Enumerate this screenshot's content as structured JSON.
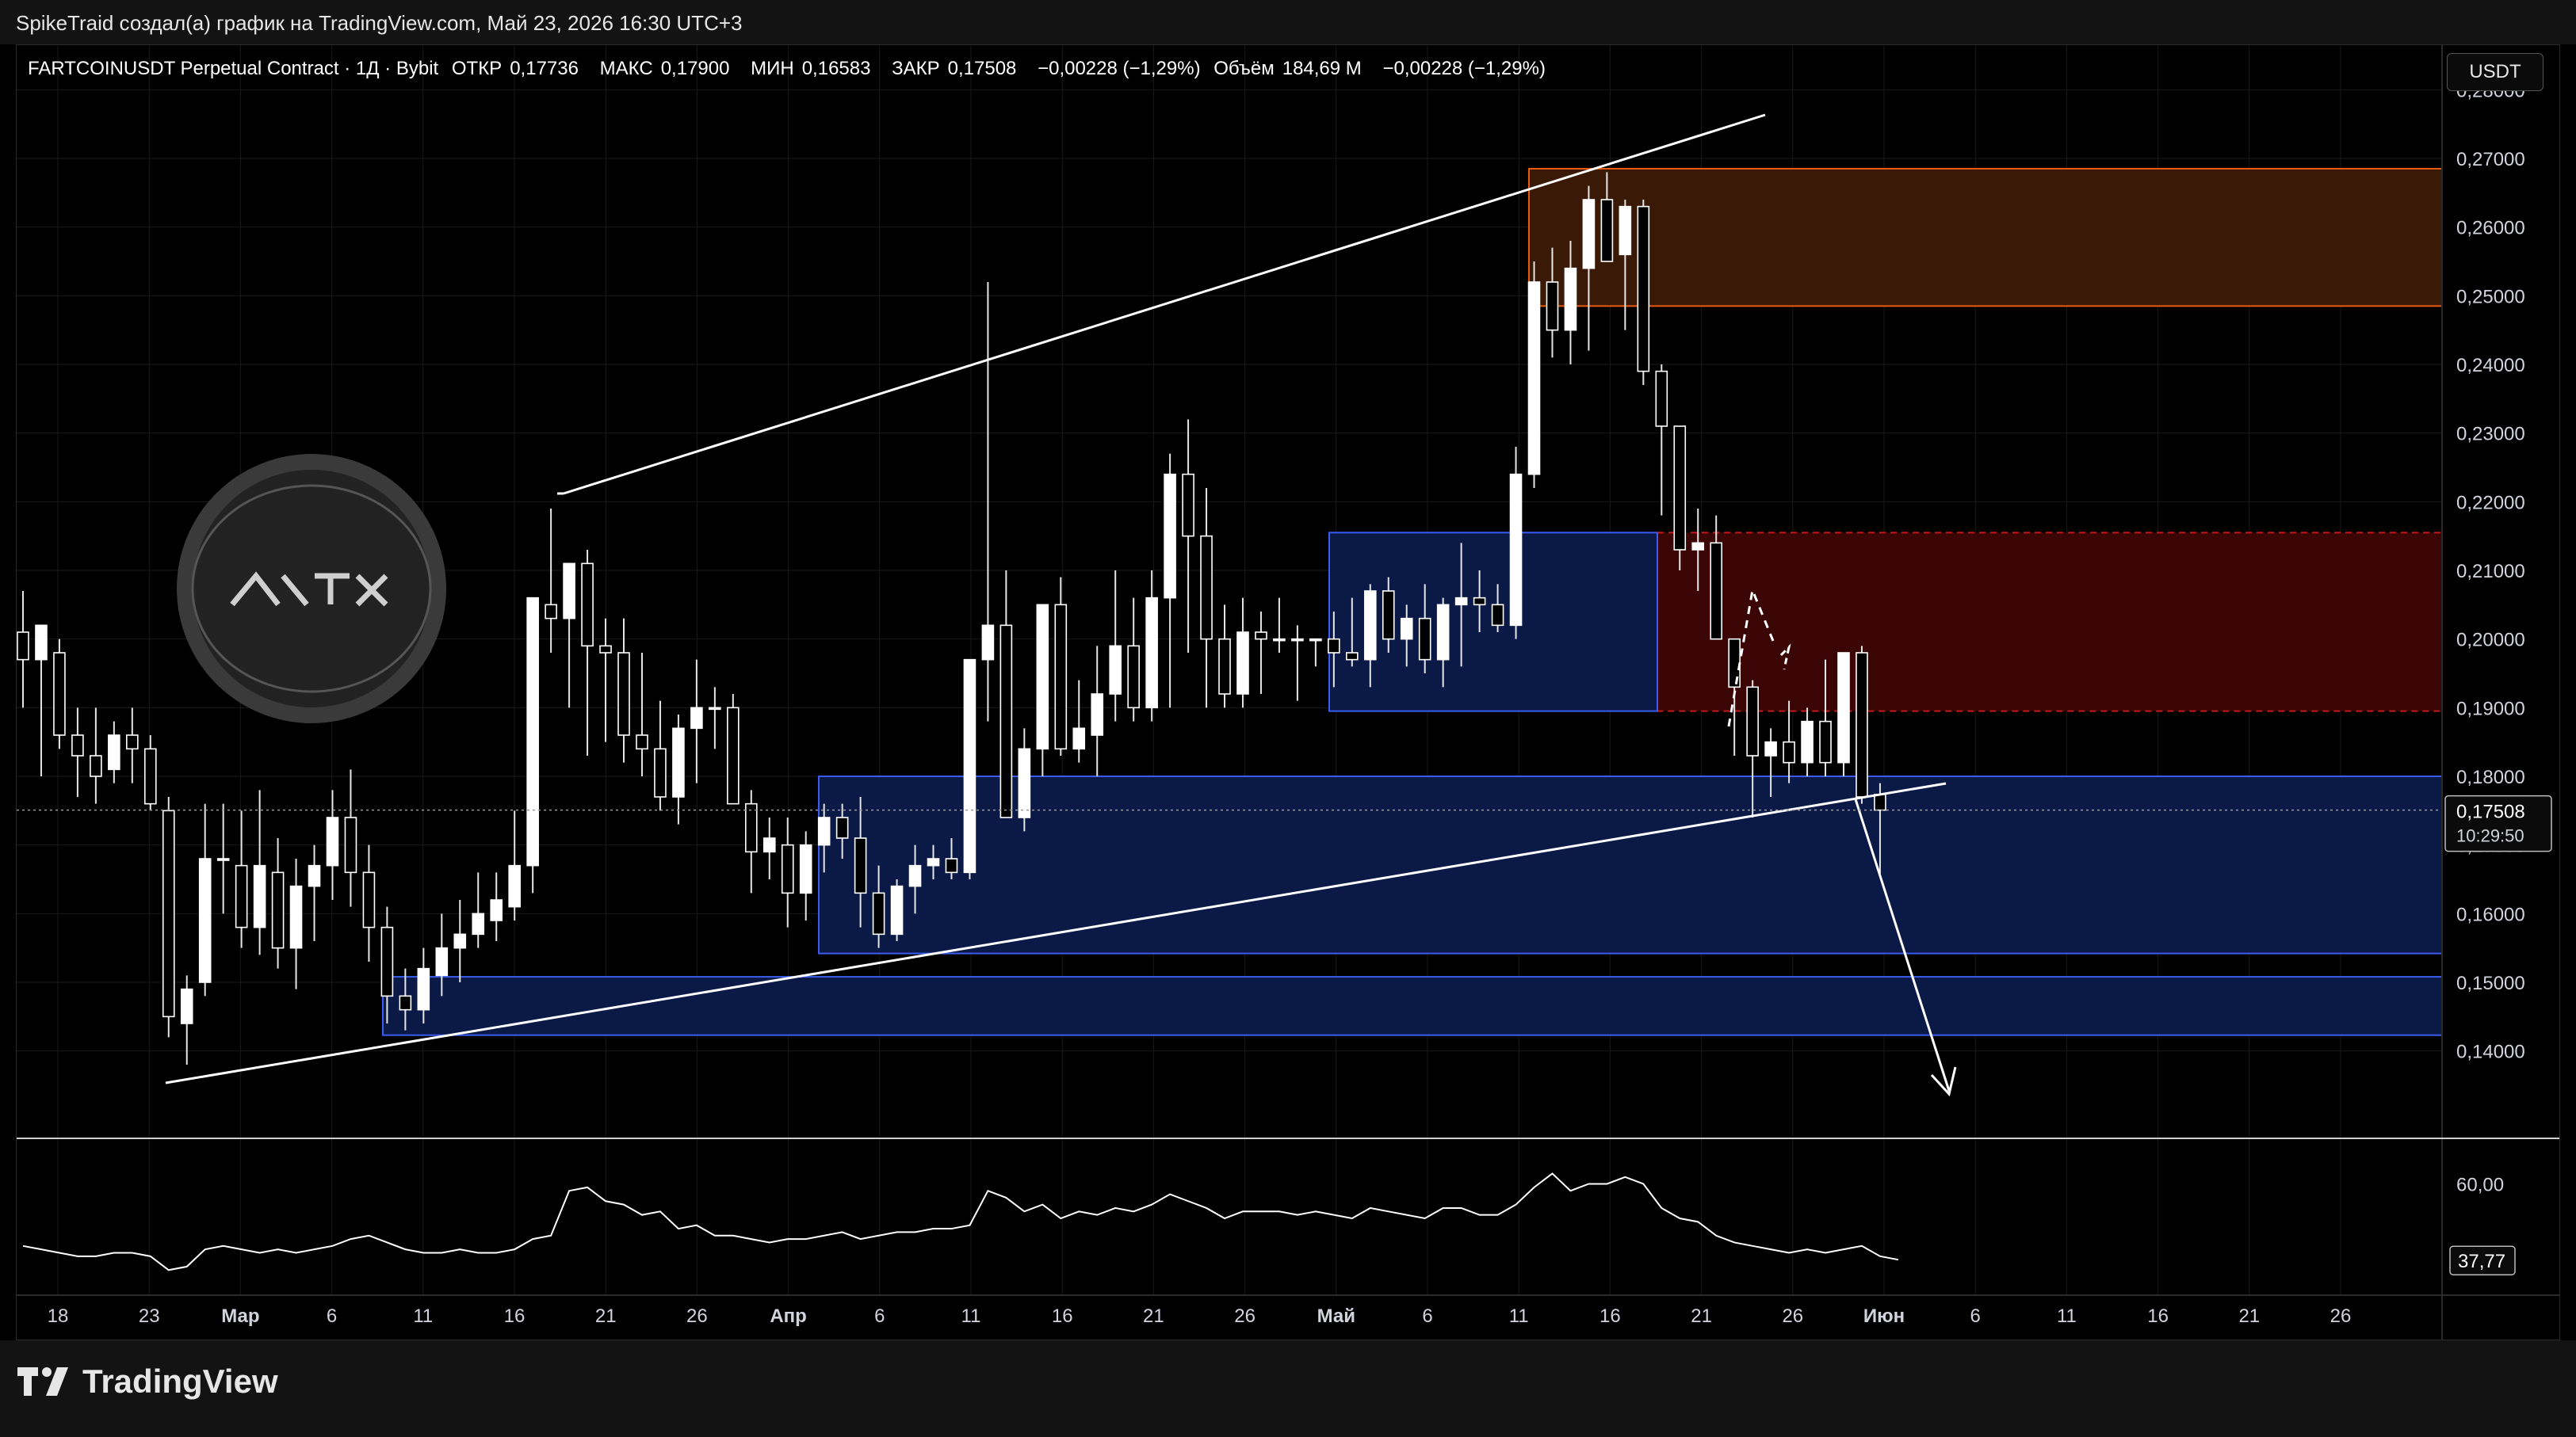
{
  "header": {
    "credit": "SpikeTraid создал(а) график на TradingView.com, Май 23, 2026 16:30 UTC+3"
  },
  "legend": {
    "symbol": "FARTCOINUSDT Perpetual Contract · 1Д · Bybit",
    "open_label": "ОТКР",
    "open": "0,17736",
    "high_label": "МАКС",
    "high": "0,17900",
    "low_label": "МИН",
    "low": "0,16583",
    "close_label": "ЗАКР",
    "close": "0,17508",
    "change": "−0,00228 (−1,29%)",
    "volume_label": "Объём",
    "volume": "184,69 M",
    "volume_change": "−0,00228 (−1,29%)"
  },
  "currency_button": "USDT",
  "footer": {
    "brand": "TradingView"
  },
  "colors": {
    "background": "#000000",
    "candle_up": "#ffffff",
    "candle_down": "#ffffff",
    "resistance_zone": "#e8590c",
    "red_zone": "#c41a1a",
    "blue_zone": "#1a3bd6",
    "trendline": "#ffffff",
    "indicator_line": "#ffffff"
  },
  "chart_data": {
    "type": "candlestick",
    "price_axis": {
      "currency": "USDT",
      "ticks": [
        "0,28000",
        "0,27000",
        "0,26000",
        "0,25000",
        "0,24000",
        "0,23000",
        "0,22000",
        "0,21000",
        "0,20000",
        "0,19000",
        "0,18000",
        "0,17000",
        "0,16000",
        "0,15000",
        "0,14000"
      ],
      "range": [
        0.1335,
        0.2835
      ],
      "last_price_label": "0,17508",
      "last_price": 0.17508,
      "countdown": "10:29:50"
    },
    "time_axis": {
      "ticks": [
        "18",
        "23",
        "Мар",
        "6",
        "11",
        "16",
        "21",
        "26",
        "Апр",
        "6",
        "11",
        "16",
        "21",
        "26",
        "Май",
        "6",
        "11",
        "16",
        "21",
        "26",
        "Июн",
        "6",
        "11",
        "16",
        "21",
        "26"
      ],
      "bold_ticks": [
        "Мар",
        "Апр",
        "Май",
        "Июн"
      ]
    },
    "candles": [
      {
        "o": 0.201,
        "h": 0.207,
        "l": 0.19,
        "c": 0.197
      },
      {
        "o": 0.197,
        "h": 0.201,
        "l": 0.18,
        "c": 0.202
      },
      {
        "o": 0.198,
        "h": 0.2,
        "l": 0.184,
        "c": 0.186
      },
      {
        "o": 0.186,
        "h": 0.19,
        "l": 0.177,
        "c": 0.183
      },
      {
        "o": 0.183,
        "h": 0.19,
        "l": 0.176,
        "c": 0.18
      },
      {
        "o": 0.181,
        "h": 0.188,
        "l": 0.179,
        "c": 0.186
      },
      {
        "o": 0.186,
        "h": 0.19,
        "l": 0.179,
        "c": 0.184
      },
      {
        "o": 0.184,
        "h": 0.186,
        "l": 0.175,
        "c": 0.176
      },
      {
        "o": 0.175,
        "h": 0.177,
        "l": 0.142,
        "c": 0.145
      },
      {
        "o": 0.144,
        "h": 0.151,
        "l": 0.138,
        "c": 0.149
      },
      {
        "o": 0.15,
        "h": 0.176,
        "l": 0.148,
        "c": 0.168
      },
      {
        "o": 0.168,
        "h": 0.176,
        "l": 0.16,
        "c": 0.168
      },
      {
        "o": 0.167,
        "h": 0.175,
        "l": 0.155,
        "c": 0.158
      },
      {
        "o": 0.158,
        "h": 0.178,
        "l": 0.154,
        "c": 0.167
      },
      {
        "o": 0.166,
        "h": 0.171,
        "l": 0.152,
        "c": 0.155
      },
      {
        "o": 0.155,
        "h": 0.168,
        "l": 0.149,
        "c": 0.164
      },
      {
        "o": 0.164,
        "h": 0.17,
        "l": 0.156,
        "c": 0.167
      },
      {
        "o": 0.167,
        "h": 0.178,
        "l": 0.162,
        "c": 0.174
      },
      {
        "o": 0.174,
        "h": 0.181,
        "l": 0.161,
        "c": 0.166
      },
      {
        "o": 0.166,
        "h": 0.17,
        "l": 0.153,
        "c": 0.158
      },
      {
        "o": 0.158,
        "h": 0.161,
        "l": 0.144,
        "c": 0.148
      },
      {
        "o": 0.148,
        "h": 0.152,
        "l": 0.143,
        "c": 0.146
      },
      {
        "o": 0.146,
        "h": 0.155,
        "l": 0.144,
        "c": 0.152
      },
      {
        "o": 0.151,
        "h": 0.16,
        "l": 0.148,
        "c": 0.155
      },
      {
        "o": 0.155,
        "h": 0.162,
        "l": 0.15,
        "c": 0.157
      },
      {
        "o": 0.157,
        "h": 0.166,
        "l": 0.155,
        "c": 0.16
      },
      {
        "o": 0.159,
        "h": 0.166,
        "l": 0.156,
        "c": 0.162
      },
      {
        "o": 0.161,
        "h": 0.175,
        "l": 0.159,
        "c": 0.167
      },
      {
        "o": 0.167,
        "h": 0.206,
        "l": 0.163,
        "c": 0.206
      },
      {
        "o": 0.205,
        "h": 0.219,
        "l": 0.198,
        "c": 0.203
      },
      {
        "o": 0.203,
        "h": 0.211,
        "l": 0.19,
        "c": 0.211
      },
      {
        "o": 0.211,
        "h": 0.213,
        "l": 0.183,
        "c": 0.199
      },
      {
        "o": 0.199,
        "h": 0.203,
        "l": 0.185,
        "c": 0.198
      },
      {
        "o": 0.198,
        "h": 0.203,
        "l": 0.182,
        "c": 0.186
      },
      {
        "o": 0.186,
        "h": 0.198,
        "l": 0.18,
        "c": 0.184
      },
      {
        "o": 0.184,
        "h": 0.191,
        "l": 0.175,
        "c": 0.177
      },
      {
        "o": 0.177,
        "h": 0.189,
        "l": 0.173,
        "c": 0.187
      },
      {
        "o": 0.187,
        "h": 0.197,
        "l": 0.179,
        "c": 0.19
      },
      {
        "o": 0.19,
        "h": 0.193,
        "l": 0.184,
        "c": 0.19
      },
      {
        "o": 0.19,
        "h": 0.192,
        "l": 0.177,
        "c": 0.176
      },
      {
        "o": 0.176,
        "h": 0.178,
        "l": 0.163,
        "c": 0.169
      },
      {
        "o": 0.169,
        "h": 0.174,
        "l": 0.165,
        "c": 0.171
      },
      {
        "o": 0.17,
        "h": 0.174,
        "l": 0.158,
        "c": 0.163
      },
      {
        "o": 0.163,
        "h": 0.172,
        "l": 0.159,
        "c": 0.17
      },
      {
        "o": 0.17,
        "h": 0.176,
        "l": 0.166,
        "c": 0.174
      },
      {
        "o": 0.174,
        "h": 0.176,
        "l": 0.168,
        "c": 0.171
      },
      {
        "o": 0.171,
        "h": 0.177,
        "l": 0.158,
        "c": 0.163
      },
      {
        "o": 0.163,
        "h": 0.167,
        "l": 0.155,
        "c": 0.157
      },
      {
        "o": 0.157,
        "h": 0.165,
        "l": 0.156,
        "c": 0.164
      },
      {
        "o": 0.164,
        "h": 0.17,
        "l": 0.16,
        "c": 0.167
      },
      {
        "o": 0.167,
        "h": 0.17,
        "l": 0.165,
        "c": 0.168
      },
      {
        "o": 0.168,
        "h": 0.171,
        "l": 0.165,
        "c": 0.166
      },
      {
        "o": 0.166,
        "h": 0.197,
        "l": 0.165,
        "c": 0.197
      },
      {
        "o": 0.197,
        "h": 0.252,
        "l": 0.188,
        "c": 0.202
      },
      {
        "o": 0.202,
        "h": 0.21,
        "l": 0.174,
        "c": 0.174
      },
      {
        "o": 0.174,
        "h": 0.187,
        "l": 0.172,
        "c": 0.184
      },
      {
        "o": 0.184,
        "h": 0.205,
        "l": 0.18,
        "c": 0.205
      },
      {
        "o": 0.205,
        "h": 0.209,
        "l": 0.183,
        "c": 0.184
      },
      {
        "o": 0.184,
        "h": 0.194,
        "l": 0.182,
        "c": 0.187
      },
      {
        "o": 0.186,
        "h": 0.199,
        "l": 0.18,
        "c": 0.192
      },
      {
        "o": 0.192,
        "h": 0.21,
        "l": 0.188,
        "c": 0.199
      },
      {
        "o": 0.199,
        "h": 0.206,
        "l": 0.188,
        "c": 0.19
      },
      {
        "o": 0.19,
        "h": 0.21,
        "l": 0.188,
        "c": 0.206
      },
      {
        "o": 0.206,
        "h": 0.227,
        "l": 0.19,
        "c": 0.224
      },
      {
        "o": 0.224,
        "h": 0.232,
        "l": 0.198,
        "c": 0.215
      },
      {
        "o": 0.215,
        "h": 0.222,
        "l": 0.19,
        "c": 0.2
      },
      {
        "o": 0.2,
        "h": 0.205,
        "l": 0.19,
        "c": 0.192
      },
      {
        "o": 0.192,
        "h": 0.206,
        "l": 0.19,
        "c": 0.201
      },
      {
        "o": 0.201,
        "h": 0.204,
        "l": 0.192,
        "c": 0.2
      },
      {
        "o": 0.2,
        "h": 0.206,
        "l": 0.198,
        "c": 0.2
      },
      {
        "o": 0.2,
        "h": 0.202,
        "l": 0.191,
        "c": 0.2
      },
      {
        "o": 0.2,
        "h": 0.2,
        "l": 0.196,
        "c": 0.2
      },
      {
        "o": 0.2,
        "h": 0.204,
        "l": 0.193,
        "c": 0.198
      },
      {
        "o": 0.198,
        "h": 0.206,
        "l": 0.196,
        "c": 0.197
      },
      {
        "o": 0.197,
        "h": 0.208,
        "l": 0.193,
        "c": 0.207
      },
      {
        "o": 0.207,
        "h": 0.209,
        "l": 0.198,
        "c": 0.2
      },
      {
        "o": 0.2,
        "h": 0.205,
        "l": 0.196,
        "c": 0.203
      },
      {
        "o": 0.203,
        "h": 0.208,
        "l": 0.195,
        "c": 0.197
      },
      {
        "o": 0.197,
        "h": 0.206,
        "l": 0.193,
        "c": 0.205
      },
      {
        "o": 0.205,
        "h": 0.214,
        "l": 0.196,
        "c": 0.206
      },
      {
        "o": 0.206,
        "h": 0.21,
        "l": 0.201,
        "c": 0.205
      },
      {
        "o": 0.205,
        "h": 0.208,
        "l": 0.201,
        "c": 0.202
      },
      {
        "o": 0.202,
        "h": 0.228,
        "l": 0.2,
        "c": 0.224
      },
      {
        "o": 0.224,
        "h": 0.255,
        "l": 0.222,
        "c": 0.252
      },
      {
        "o": 0.252,
        "h": 0.257,
        "l": 0.241,
        "c": 0.245
      },
      {
        "o": 0.245,
        "h": 0.258,
        "l": 0.24,
        "c": 0.254
      },
      {
        "o": 0.254,
        "h": 0.266,
        "l": 0.242,
        "c": 0.264
      },
      {
        "o": 0.264,
        "h": 0.268,
        "l": 0.255,
        "c": 0.255
      },
      {
        "o": 0.256,
        "h": 0.264,
        "l": 0.245,
        "c": 0.263
      },
      {
        "o": 0.263,
        "h": 0.264,
        "l": 0.237,
        "c": 0.239
      },
      {
        "o": 0.239,
        "h": 0.24,
        "l": 0.218,
        "c": 0.231
      },
      {
        "o": 0.231,
        "h": 0.231,
        "l": 0.21,
        "c": 0.213
      },
      {
        "o": 0.213,
        "h": 0.219,
        "l": 0.207,
        "c": 0.214
      },
      {
        "o": 0.214,
        "h": 0.218,
        "l": 0.2,
        "c": 0.2
      },
      {
        "o": 0.2,
        "h": 0.2,
        "l": 0.183,
        "c": 0.193
      },
      {
        "o": 0.193,
        "h": 0.194,
        "l": 0.174,
        "c": 0.183
      },
      {
        "o": 0.183,
        "h": 0.187,
        "l": 0.177,
        "c": 0.185
      },
      {
        "o": 0.185,
        "h": 0.191,
        "l": 0.179,
        "c": 0.182
      },
      {
        "o": 0.182,
        "h": 0.19,
        "l": 0.18,
        "c": 0.188
      },
      {
        "o": 0.188,
        "h": 0.197,
        "l": 0.18,
        "c": 0.182
      },
      {
        "o": 0.182,
        "h": 0.198,
        "l": 0.18,
        "c": 0.198
      },
      {
        "o": 0.198,
        "h": 0.199,
        "l": 0.176,
        "c": 0.177
      },
      {
        "o": 0.17736,
        "h": 0.179,
        "l": 0.16583,
        "c": 0.17508
      }
    ],
    "drawings": {
      "zones": [
        {
          "name": "resistance-zone-orange",
          "top": 0.2685,
          "bottom": 0.2485,
          "color": "#e8590c",
          "dashed": false
        },
        {
          "name": "red-zone",
          "top": 0.2155,
          "bottom": 0.1895,
          "color": "#c41a1a",
          "dashed": true
        },
        {
          "name": "blue-zone-mid",
          "top": 0.2155,
          "bottom": 0.1895,
          "color": "#1a3bd6",
          "dashed": false
        },
        {
          "name": "blue-zone-low",
          "top": 0.18,
          "bottom": 0.1542,
          "color": "#1a3bd6",
          "dashed": false
        },
        {
          "name": "blue-zone-bottom",
          "top": 0.1508,
          "bottom": 0.1423,
          "color": "#1a3bd6",
          "dashed": false
        }
      ]
    },
    "indicator": {
      "type": "line",
      "axis_ticks": [
        "60,00"
      ],
      "last_value_label": "37,77",
      "last_value": 37.77,
      "values": [
        42,
        41,
        40,
        39,
        39,
        40,
        40,
        39,
        35,
        36,
        41,
        42,
        41,
        40,
        41,
        40,
        41,
        42,
        44,
        45,
        43,
        41,
        40,
        40,
        41,
        40,
        40,
        41,
        44,
        45,
        58,
        59,
        55,
        54,
        51,
        52,
        47,
        48,
        45,
        45,
        44,
        43,
        44,
        44,
        45,
        46,
        44,
        45,
        46,
        46,
        47,
        47,
        48,
        58,
        56,
        52,
        54,
        50,
        52,
        51,
        53,
        52,
        54,
        57,
        55,
        53,
        50,
        52,
        52,
        52,
        51,
        52,
        51,
        50,
        53,
        52,
        51,
        50,
        53,
        53,
        51,
        51,
        54,
        59,
        63,
        58,
        60,
        60,
        62,
        60,
        53,
        50,
        49,
        45,
        43,
        42,
        41,
        40,
        41,
        40,
        41,
        42,
        39,
        38
      ]
    }
  }
}
